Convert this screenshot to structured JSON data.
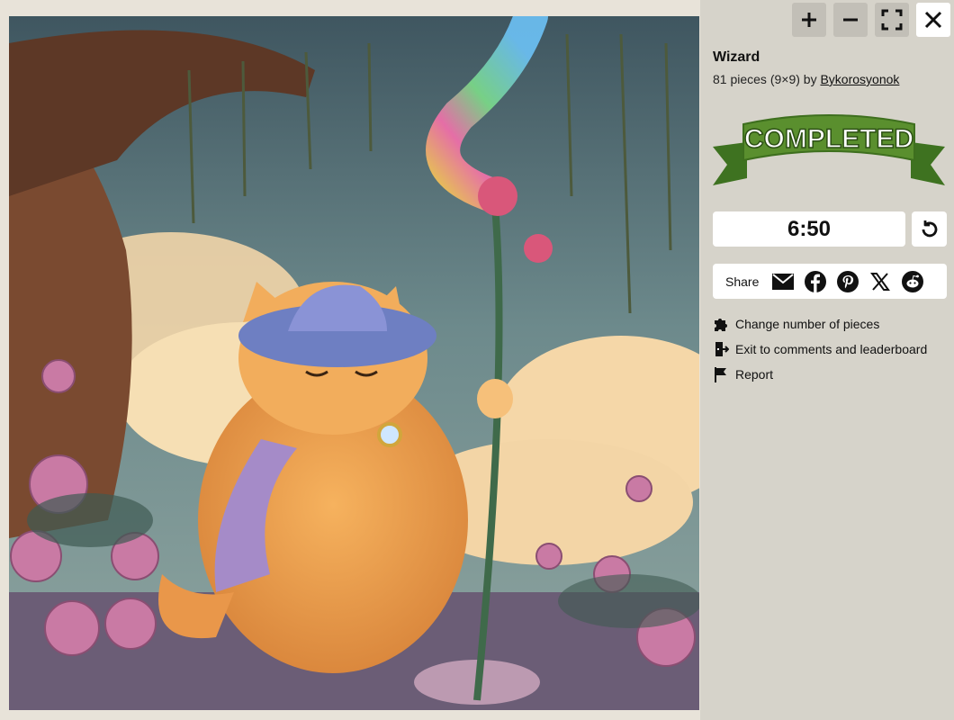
{
  "puzzle": {
    "image_alt": "Wizard cat with rainbow staff in rose garden"
  },
  "controls": {
    "zoom_in_icon": "plus-icon",
    "zoom_out_icon": "minus-icon",
    "fullscreen_icon": "fullscreen-icon",
    "close_icon": "close-icon"
  },
  "info": {
    "title": "Wizard",
    "pieces_text": "81 pieces (9×9) by ",
    "author": "Bykorosyonok"
  },
  "badge": {
    "text": "COMPLETED",
    "color": "#5a8f2e"
  },
  "timer": {
    "value": "6:50"
  },
  "share": {
    "label": "Share",
    "icons": [
      "email-icon",
      "facebook-icon",
      "pinterest-icon",
      "x-icon",
      "reddit-icon"
    ]
  },
  "menu": {
    "change_pieces": "Change number of pieces",
    "exit": "Exit to comments and leaderboard",
    "report": "Report"
  }
}
